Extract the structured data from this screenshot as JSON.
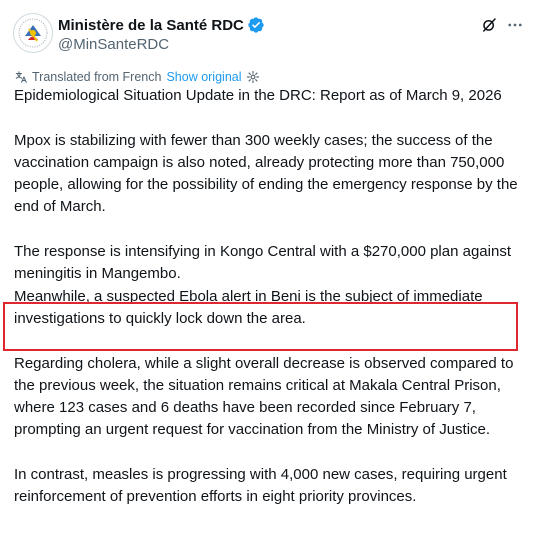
{
  "author": {
    "display_name": "Ministère de la Santé RDC",
    "handle": "@MinSanteRDC",
    "verified_icon": "verified-badge-icon",
    "verified_color": "#1d9bf0"
  },
  "actions": {
    "grok_icon": "grok-icon",
    "more_icon": "more-icon"
  },
  "translation": {
    "label": "Translated from French",
    "show_original": "Show original",
    "link_color": "#1d9bf0"
  },
  "post": {
    "title": "Epidemiological Situation Update in the DRC: Report as of March 9, 2026",
    "p1": "Mpox is stabilizing with fewer than 300 weekly cases; the success of the vaccination campaign is also noted, already protecting more than 750,000 people, allowing for the possibility of ending the emergency response by the end of March.",
    "p2": "The response is intensifying in Kongo Central with a $270,000 plan against meningitis in Mangembo.",
    "p3": "Meanwhile, a suspected Ebola alert in Beni is the subject of immediate investigations to quickly lock down the area.",
    "p4": "Regarding cholera, while a slight overall decrease is observed compared to the previous week, the situation remains critical at Makala Central Prison, where 123 cases and 6 deaths have been recorded since February 7, prompting an urgent request for vaccination from the Ministry of Justice.",
    "p5": "In contrast, measles is progressing with 4,000 new cases, requiring urgent reinforcement of prevention efforts in eight priority provinces."
  },
  "highlight": {
    "color": "#e0262e"
  }
}
